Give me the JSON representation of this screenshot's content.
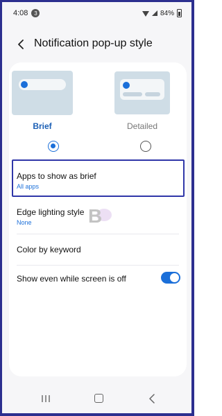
{
  "status_bar": {
    "time": "4:08",
    "notification_count": "3",
    "battery": "84%"
  },
  "header": {
    "back_icon": "back-arrow-icon",
    "title": "Notification pop-up style"
  },
  "style_options": [
    {
      "label": "Brief",
      "selected": true
    },
    {
      "label": "Detailed",
      "selected": false
    }
  ],
  "settings": [
    {
      "title": "Apps to show as brief",
      "subtitle": "All apps",
      "highlighted": true
    },
    {
      "title": "Edge lighting style",
      "subtitle": "None"
    },
    {
      "title": "Color by keyword"
    },
    {
      "title": "Show even while screen is off",
      "toggle_on": true
    }
  ],
  "watermark": "B",
  "colors": {
    "accent": "#1b6fd9",
    "highlight_border": "#2f36a8",
    "frame_border": "#2c2f8f"
  },
  "nav_icons": [
    "recent-apps-icon",
    "home-icon",
    "back-icon"
  ]
}
